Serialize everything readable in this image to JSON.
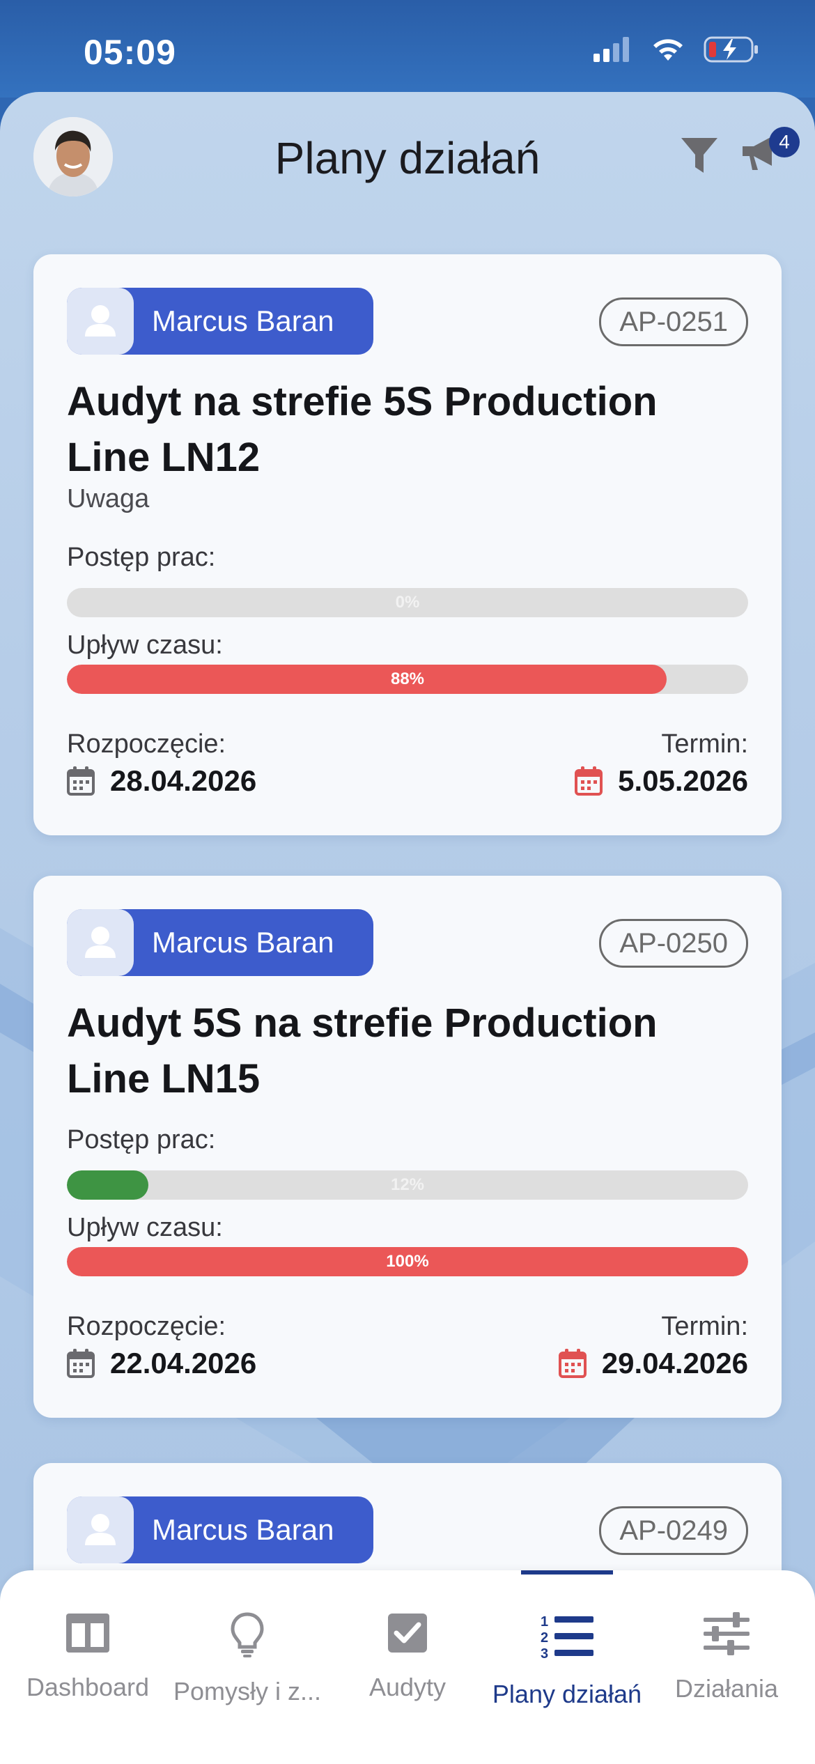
{
  "status": {
    "time": "05:09"
  },
  "header": {
    "title": "Plany działań",
    "notification_count": "4"
  },
  "cards": [
    {
      "assignee": "Marcus Baran",
      "code": "AP-0251",
      "title": "Audyt na strefie 5S Production Line LN12",
      "subtitle": "Uwaga",
      "progress_label": "Postęp prac:",
      "progress_value": 0,
      "progress_text": "0%",
      "time_label": "Upływ czasu:",
      "time_value": 88,
      "time_text": "88%",
      "start_label": "Rozpoczęcie:",
      "start_date": "28.04.2026",
      "due_label": "Termin:",
      "due_date": "5.05.2026"
    },
    {
      "assignee": "Marcus Baran",
      "code": "AP-0250",
      "title": "Audyt 5S na strefie Production Line LN15",
      "progress_label": "Postęp prac:",
      "progress_value": 12,
      "progress_text": "12%",
      "time_label": "Upływ czasu:",
      "time_value": 100,
      "time_text": "100%",
      "start_label": "Rozpoczęcie:",
      "start_date": "22.04.2026",
      "due_label": "Termin:",
      "due_date": "29.04.2026"
    },
    {
      "assignee": "Marcus Baran",
      "code": "AP-0249"
    }
  ],
  "tabs": [
    {
      "label": "Dashboard",
      "icon": "dashboard-icon"
    },
    {
      "label": "Pomysły i z...",
      "icon": "lightbulb-icon"
    },
    {
      "label": "Audyty",
      "icon": "checkbox-icon"
    },
    {
      "label": "Plany działań",
      "icon": "numbered-list-icon",
      "active": true
    },
    {
      "label": "Działania",
      "icon": "sliders-icon"
    }
  ],
  "colors": {
    "accent": "#3d5ccc",
    "active_tab": "#1e3a8a",
    "time_bar": "#eb5757",
    "progress_bar": "#3e9443",
    "due_icon": "#e05252"
  }
}
